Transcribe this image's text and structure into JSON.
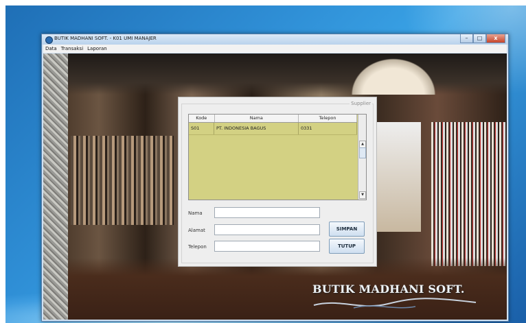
{
  "window": {
    "title": "BUTIK MADHANI SOFT. - K01 UMI MANAJER",
    "buttons": {
      "minimize": "–",
      "maximize": "□",
      "close": "x"
    }
  },
  "menu": {
    "items": [
      "Data",
      "Transaksi",
      "Laporan"
    ]
  },
  "background": {
    "brand": "BUTIK MADHANI SOFT."
  },
  "panel": {
    "title": "Supplier",
    "table": {
      "headers": [
        "Kode",
        "Nama",
        "Telepon"
      ],
      "rows": [
        [
          "S01",
          "PT. INDONESIA BAGUS",
          "0331"
        ]
      ]
    },
    "fields": {
      "nama_label": "Nama",
      "nama_value": "",
      "alamat_label": "Alamat",
      "alamat_value": "",
      "telepon_label": "Telepon",
      "telepon_value": ""
    },
    "buttons": {
      "simpan": "SIMPAN",
      "tutup": "TUTUP"
    }
  },
  "colors": {
    "table_bg": "#d3d183",
    "panel_bg": "#eeeeee"
  }
}
